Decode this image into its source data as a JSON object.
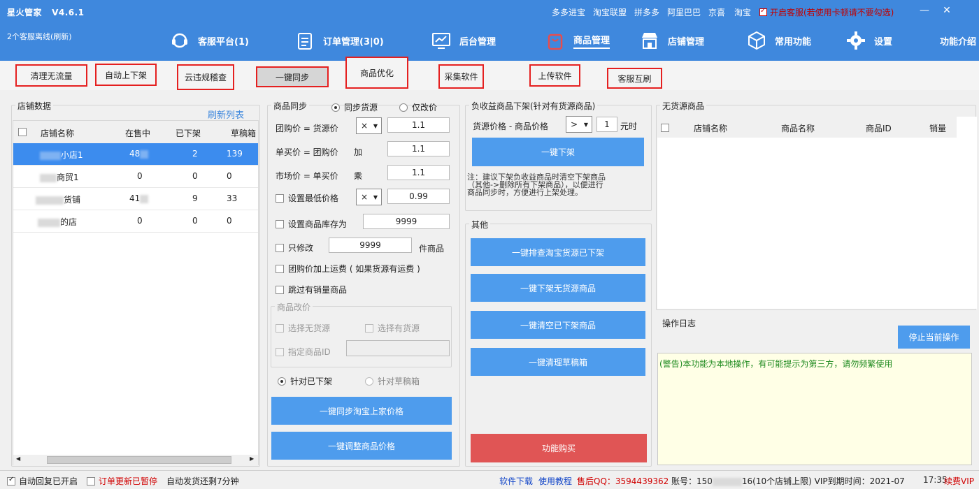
{
  "app": {
    "title": "星火管家",
    "version": "V4.6.1",
    "status": "2个客服离线(刷新)"
  },
  "toplinks": [
    "多多进宝",
    "淘宝联盟",
    "拼多多",
    "阿里巴巴",
    "京喜",
    "淘宝"
  ],
  "kf_toggle": "开启客服(若使用卡顿请不要勾选)",
  "nav": [
    {
      "label": "客服平台(1)",
      "icon": "headset-icon"
    },
    {
      "label": "订单管理(3|0)",
      "icon": "clipboard-icon"
    },
    {
      "label": "后台管理",
      "icon": "monitor-icon"
    },
    {
      "label": "商品管理",
      "icon": "bag-icon"
    },
    {
      "label": "店铺管理",
      "icon": "store-icon"
    },
    {
      "label": "常用功能",
      "icon": "cube-icon"
    },
    {
      "label": "设置",
      "icon": "gear-icon"
    }
  ],
  "nav_intro": "功能介绍",
  "subtabs": [
    "清理无流量",
    "自动上下架",
    "云违规稽查",
    "一键同步",
    "商品优化",
    "采集软件",
    "上传软件",
    "客服互刷"
  ],
  "shop_panel": {
    "legend": "店铺数据",
    "refresh": "刷新列表",
    "columns": [
      "店铺名称",
      "在售中",
      "已下架",
      "草稿箱"
    ],
    "rows": [
      {
        "name": "小店1",
        "on_sale": "48",
        "off": "2",
        "draft": "139"
      },
      {
        "name": "商贸1",
        "on_sale": "0",
        "off": "0",
        "draft": "0"
      },
      {
        "name": "货铺",
        "on_sale": "41",
        "off": "9",
        "draft": "33"
      },
      {
        "name": "的店",
        "on_sale": "0",
        "off": "0",
        "draft": "0"
      }
    ]
  },
  "sync_panel": {
    "legend": "商品同步",
    "radio_sync": "同步货源",
    "radio_price": "仅改价",
    "group_price_label": "团购价 = 货源价",
    "group_op": "×",
    "group_val": "1.1",
    "single_label": "单买价 = 团购价",
    "single_op": "加",
    "single_val": "1.1",
    "market_label": "市场价 = 单买价",
    "market_op": "乘",
    "market_val": "1.1",
    "min_price_label": "设置最低价格",
    "min_op": "×",
    "min_val": "0.99",
    "stock_label": "设置商品库存为",
    "stock_val": "9999",
    "only_label": "只修改",
    "only_val": "9999",
    "only_unit": "件商品",
    "shipping_label": "团购价加上运费 ( 如果货源有运费 )",
    "skip_label": "跳过有销量商品",
    "modify_legend": "商品改价",
    "no_source": "选择无货源",
    "has_source": "选择有货源",
    "assign_id": "指定商品ID",
    "target_off": "针对已下架",
    "target_draft": "针对草稿箱",
    "btn_sync": "一键同步淘宝上家价格",
    "btn_adjust": "一键调整商品价格"
  },
  "neg_panel": {
    "legend": "负收益商品下架(针对有货源商品)",
    "label": "货源价格 - 商品价格",
    "op": ">",
    "val": "1",
    "unit": "元时",
    "btn": "一键下架",
    "note": "注：建议下架负收益商品时清空下架商品\n（其他->删除所有下架商品），以便进行\n商品同步时，方便进行上架处理。"
  },
  "other_panel": {
    "legend": "其他",
    "btns": [
      "一键排查淘宝货源已下架",
      "一键下架无货源商品",
      "一键清空已下架商品",
      "一键清理草稿箱"
    ],
    "buy": "功能购买"
  },
  "nosrc_panel": {
    "legend": "无货源商品",
    "columns": [
      "店铺名称",
      "商品名称",
      "商品ID",
      "销量"
    ]
  },
  "log_panel": {
    "legend": "操作日志",
    "stop": "停止当前操作",
    "message": "(警告)本功能为本地操作，有可能提示为第三方，请勿频繁使用"
  },
  "statusbar": {
    "auto_reply": "自动回复已开启",
    "order_paused": "订单更新已暂停",
    "auto_ship": "自动发货还剩7分钟",
    "download": "软件下载",
    "tutorial": "使用教程",
    "qq": "售后QQ：3594439362",
    "account": "账号：150",
    "account_tail": "16(10个店铺上限) VIP到期时间：2021-07",
    "time": "17:35",
    "renew": "续费VIP"
  },
  "colors": {
    "primary": "#3f88dd",
    "button": "#4e9ced",
    "danger": "#e05555",
    "tab_border": "#e52020"
  }
}
